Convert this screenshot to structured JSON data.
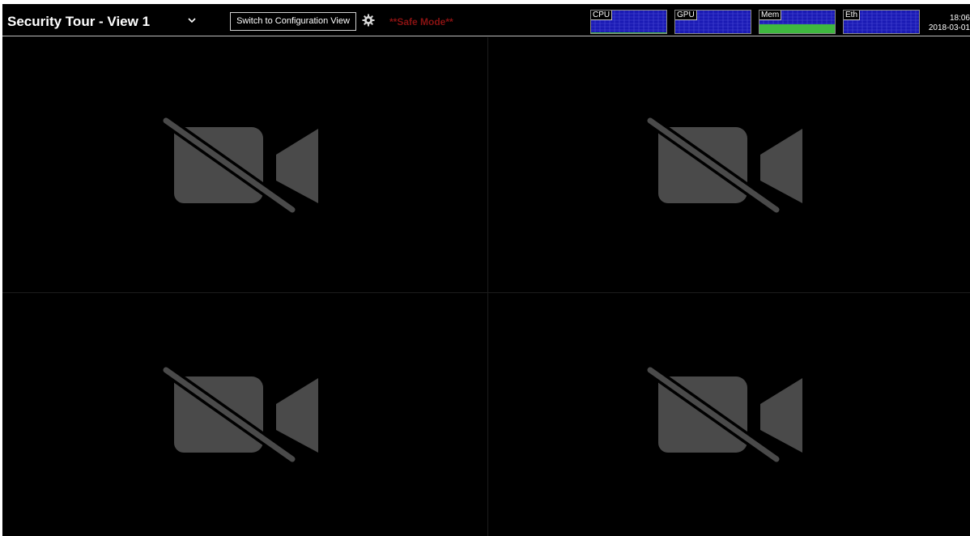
{
  "header": {
    "view_title": "Security Tour - View 1",
    "switch_button_label": "Switch to Configuration View",
    "safe_mode_text": "**Safe Mode**",
    "meters": [
      {
        "label": "CPU",
        "level": 0.05,
        "fill_color": "#3fb83f"
      },
      {
        "label": "GPU",
        "level": 0.0,
        "fill_color": "#3fb83f"
      },
      {
        "label": "Mem",
        "level": 0.4,
        "fill_color": "#3fb83f"
      },
      {
        "label": "Eth",
        "level": 0.0,
        "fill_color": "#3fb83f"
      }
    ],
    "clock": {
      "time": "18:06",
      "date": "2018-03-01"
    }
  },
  "colors": {
    "background": "#000000",
    "safe_mode": "#8a1212",
    "meter_background": "#1a1ab4",
    "camera_icon": "#4a4a4a"
  },
  "tiles": [
    {
      "icon": "camera-off-icon"
    },
    {
      "icon": "camera-off-icon"
    },
    {
      "icon": "camera-off-icon"
    },
    {
      "icon": "camera-off-icon"
    }
  ]
}
